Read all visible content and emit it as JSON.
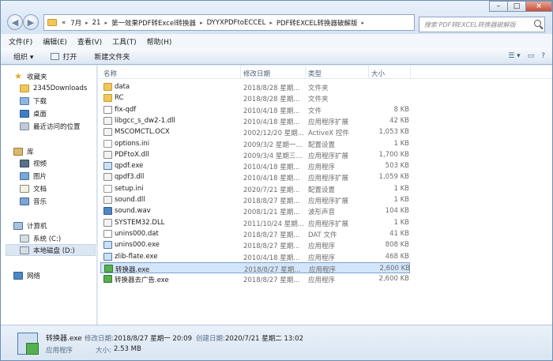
{
  "address_bar": {
    "overflow": "«",
    "crumbs": [
      "7月",
      "21",
      "第一效果PDF转Excel转换器",
      "DYYXPDFtoECCEL",
      "PDF转EXCEL转换器破解版"
    ]
  },
  "search": {
    "placeholder": "搜索 PDF转EXCEL转换器破解版"
  },
  "window_controls": {
    "minimize": "–",
    "maximize": "□",
    "close": "×"
  },
  "menu": [
    "文件(F)",
    "编辑(E)",
    "查看(V)",
    "工具(T)",
    "帮助(H)"
  ],
  "toolbar": {
    "organize": "组织 ▾",
    "open": "打开",
    "new_folder": "新建文件夹",
    "view": "☰ ▾"
  },
  "sidebar": {
    "favorites_label": "收藏夹",
    "favorites": [
      "2345Downloads",
      "下载",
      "桌面",
      "最近访问的位置"
    ],
    "libraries_label": "库",
    "libraries": [
      "视频",
      "图片",
      "文档",
      "音乐"
    ],
    "computer_label": "计算机",
    "drives": [
      "系统 (C:)",
      "本地磁盘 (D:)"
    ],
    "network_label": "网络"
  },
  "columns": {
    "name": "名称",
    "date": "修改日期",
    "type": "类型",
    "size": "大小"
  },
  "files": [
    {
      "name": "data",
      "date": "2018/8/28 星期...",
      "type": "文件夹",
      "size": "",
      "icon": "folder-icon"
    },
    {
      "name": "RC",
      "date": "2018/8/28 星期...",
      "type": "文件夹",
      "size": "",
      "icon": "folder-icon"
    },
    {
      "name": "fix-qdf",
      "date": "2010/4/18 星期...",
      "type": "文件",
      "size": "8 KB",
      "icon": "file-icon"
    },
    {
      "name": "libgcc_s_dw2-1.dll",
      "date": "2010/4/18 星期...",
      "type": "应用程序扩展",
      "size": "42 KB",
      "icon": "dll-icon"
    },
    {
      "name": "MSCOMCTL.OCX",
      "date": "2002/12/20 星期...",
      "type": "ActiveX 控件",
      "size": "1,053 KB",
      "icon": "dll-icon"
    },
    {
      "name": "options.ini",
      "date": "2009/3/2 星期一...",
      "type": "配置设置",
      "size": "1 KB",
      "icon": "ini-icon"
    },
    {
      "name": "PDFtoX.dll",
      "date": "2009/3/4 星期三...",
      "type": "应用程序扩展",
      "size": "1,700 KB",
      "icon": "dll-icon"
    },
    {
      "name": "qpdf.exe",
      "date": "2010/4/18 星期...",
      "type": "应用程序",
      "size": "503 KB",
      "icon": "exe-icon"
    },
    {
      "name": "qpdf3.dll",
      "date": "2010/4/18 星期...",
      "type": "应用程序扩展",
      "size": "1,059 KB",
      "icon": "dll-icon"
    },
    {
      "name": "setup.ini",
      "date": "2020/7/21 星期...",
      "type": "配置设置",
      "size": "1 KB",
      "icon": "ini-icon"
    },
    {
      "name": "sound.dll",
      "date": "2018/8/27 星期...",
      "type": "应用程序扩展",
      "size": "1 KB",
      "icon": "dll-icon"
    },
    {
      "name": "sound.wav",
      "date": "2008/1/21 星期...",
      "type": "波形声音",
      "size": "104 KB",
      "icon": "sound-icon"
    },
    {
      "name": "SYSTEM32.DLL",
      "date": "2011/10/24 星期...",
      "type": "应用程序扩展",
      "size": "1 KB",
      "icon": "dll-icon"
    },
    {
      "name": "unins000.dat",
      "date": "2018/8/27 星期...",
      "type": "DAT 文件",
      "size": "41 KB",
      "icon": "file-icon"
    },
    {
      "name": "unins000.exe",
      "date": "2018/8/27 星期...",
      "type": "应用程序",
      "size": "808 KB",
      "icon": "exe-icon"
    },
    {
      "name": "zlib-flate.exe",
      "date": "2010/4/18 星期...",
      "type": "应用程序",
      "size": "468 KB",
      "icon": "exe-icon"
    },
    {
      "name": "转换器.exe",
      "date": "2018/8/27 星期...",
      "type": "应用程序",
      "size": "2,600 KB",
      "icon": "app-icon",
      "selected": true
    },
    {
      "name": "转换器去广告.exe",
      "date": "2018/8/27 星期...",
      "type": "应用程序",
      "size": "2,600 KB",
      "icon": "app-icon"
    }
  ],
  "details_pane": {
    "name": "转换器.exe",
    "modified_label": "修改日期:",
    "modified_value": "2018/8/27 星期一 20:09",
    "created_label": "创建日期:",
    "created_value": "2020/7/21 星期二 13:02",
    "type": "应用程序",
    "size_label": "大小:",
    "size_value": "2.53 MB"
  },
  "colors": {
    "selection": "#d3e5fa",
    "selection_border": "#7da2ce",
    "chrome": "#dfe9f5"
  }
}
